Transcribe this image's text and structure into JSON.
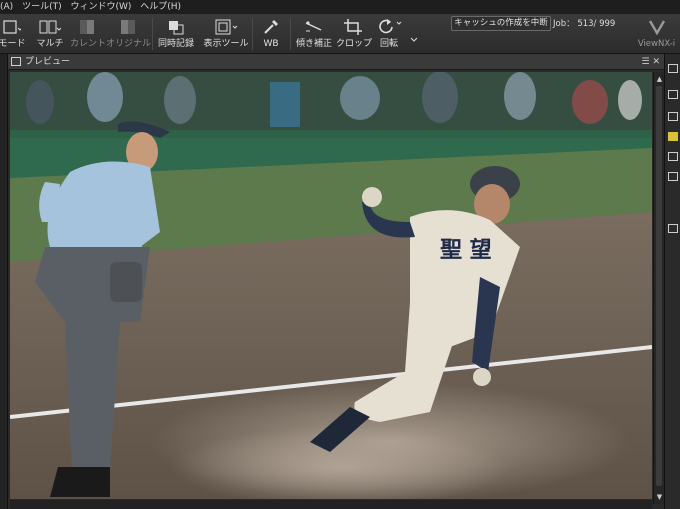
{
  "menu": {
    "items": [
      "(A)",
      "ツール(T)",
      "ウィンドウ(W)",
      "ヘルプ(H)"
    ]
  },
  "toolbar": {
    "buttons": [
      {
        "label": "モード",
        "icon": "mode-icon"
      },
      {
        "label": "マルチ",
        "icon": "multi-icon"
      },
      {
        "label": "カレント",
        "icon": "current-icon"
      },
      {
        "label": "オリジナル",
        "icon": "original-icon"
      },
      {
        "label": "同時記録",
        "icon": "simultaneous-record-icon"
      },
      {
        "label": "表示ツール",
        "icon": "display-tool-icon"
      },
      {
        "label": "WB",
        "icon": "eyedropper-icon"
      },
      {
        "label": "傾き補正",
        "icon": "straighten-icon"
      },
      {
        "label": "クロップ",
        "icon": "crop-icon"
      },
      {
        "label": "回転",
        "icon": "rotate-icon"
      }
    ],
    "cancel_label": "キャッシュの作成を中断",
    "job_label": "Job：",
    "job_value": "513/ 999",
    "viewnx_label": "ViewNX-i"
  },
  "preview": {
    "title": "プレビュー",
    "photo_alt": "baseball-player-sliding-home-photo",
    "jersey_text": "聖 望"
  },
  "colors": {
    "toolbar_bg": "#333333",
    "panel_bg": "#2a2a2a",
    "infield_dirt": "#6b5e52",
    "outfield_grass": "#5d7a4c"
  }
}
